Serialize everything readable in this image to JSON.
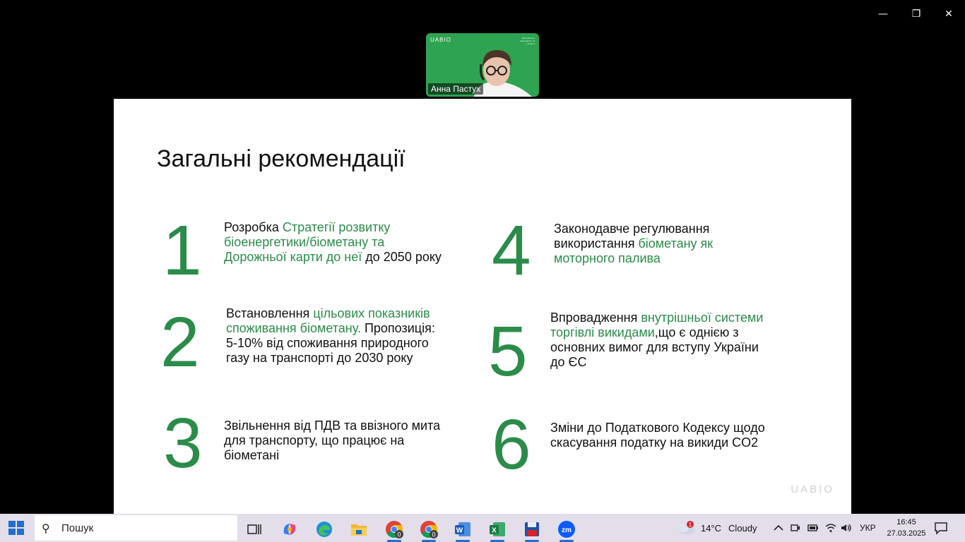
{
  "window": {
    "minimize": "—",
    "restore": "❐",
    "close": "✕"
  },
  "participant": {
    "name": "Анна Пастух",
    "brand": "UABIO",
    "small_text": "Biomethane Association of Ukraine"
  },
  "slide": {
    "title": "Загальні рекомендації",
    "logo": "UABIO",
    "recommendations": [
      {
        "num": "1",
        "parts": [
          {
            "t": "Розробка ",
            "hl": false
          },
          {
            "t": "Стратегії розвитку біоенергетики/біометану та Дорожньої карти до неї",
            "hl": true
          },
          {
            "t": " до 2050 року",
            "hl": false
          }
        ]
      },
      {
        "num": "2",
        "parts": [
          {
            "t": "Встановлення ",
            "hl": false
          },
          {
            "t": "цільових показників споживання біометану.",
            "hl": true
          },
          {
            "t": " Пропозиція: 5-10% від споживання природного газу на транспорті до 2030 року",
            "hl": false
          }
        ]
      },
      {
        "num": "3",
        "parts": [
          {
            "t": "Звільнення від ПДВ та ввізного мита для транспорту, що працює на біометані",
            "hl": false
          }
        ]
      },
      {
        "num": "4",
        "parts": [
          {
            "t": "Законодавче регулювання використання ",
            "hl": false
          },
          {
            "t": "біометану як моторного палива",
            "hl": true
          }
        ]
      },
      {
        "num": "5",
        "parts": [
          {
            "t": "Впровадження ",
            "hl": false
          },
          {
            "t": "внутрішньої системи торгівлі викидами",
            "hl": true
          },
          {
            "t": ",що є однією з основних вимог для вступу України до ЄС",
            "hl": false
          }
        ]
      },
      {
        "num": "6",
        "parts": [
          {
            "t": "Зміни до Податкового Кодексу щодо скасування податку на викиди CO2",
            "hl": false
          }
        ]
      }
    ]
  },
  "taskbar": {
    "search_placeholder": "Пошук",
    "weather": {
      "temp": "14°C",
      "condition": "Cloudy",
      "badge": "1"
    },
    "language": "УКР",
    "time": "16:45",
    "date": "27.03.2025",
    "chrome_badge_1": "0",
    "chrome_badge_2": "0",
    "zoom_label": "zm",
    "colors": {
      "accent": "#2b8c4a",
      "taskbar_bg": "#e4ddea"
    }
  }
}
